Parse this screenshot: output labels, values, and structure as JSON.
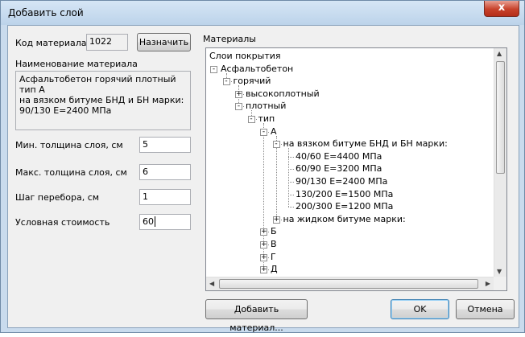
{
  "window": {
    "title": "Добавить слой",
    "close_glyph": "x"
  },
  "material": {
    "code_label": "Код материала",
    "code_value": "1022",
    "assign_button": "Назначить",
    "name_label": "Наименование материала",
    "name_value_lines": [
      "Асфальтобетон горячий плотный тип А",
      "на вязком битуме БНД и БН марки:",
      "90/130 E=2400 МПа"
    ]
  },
  "params": {
    "min_label": "Мин. толщина слоя, см",
    "min_value": "5",
    "max_label": "Макс. толщина слоя, см",
    "max_value": "6",
    "step_label": "Шаг перебора, см",
    "step_value": "1",
    "cost_label": "Условная стоимость",
    "cost_value": "60"
  },
  "materials": {
    "label": "Материалы",
    "nodes": [
      {
        "text": "Слои покрытия",
        "level": 0,
        "expander": ""
      },
      {
        "text": "Асфальтобетон",
        "level": 1,
        "expander": "-"
      },
      {
        "text": "горячий",
        "level": 2,
        "expander": "-"
      },
      {
        "text": "высокоплотный",
        "level": 3,
        "expander": "+"
      },
      {
        "text": "плотный",
        "level": 3,
        "expander": "-"
      },
      {
        "text": "тип",
        "level": 4,
        "expander": "-"
      },
      {
        "text": "А",
        "level": 5,
        "expander": "-"
      },
      {
        "text": "на вязком битуме БНД и БН марки:",
        "level": 6,
        "expander": "-"
      },
      {
        "text": "40/60 E=4400 МПа",
        "level": 7,
        "expander": ""
      },
      {
        "text": "60/90 E=3200 МПа",
        "level": 7,
        "expander": ""
      },
      {
        "text": "90/130 E=2400 МПа",
        "level": 7,
        "expander": ""
      },
      {
        "text": "130/200 E=1500 МПа",
        "level": 7,
        "expander": ""
      },
      {
        "text": "200/300 E=1200 МПа",
        "level": 7,
        "expander": ""
      },
      {
        "text": "на жидком битуме марки:",
        "level": 6,
        "expander": "+"
      },
      {
        "text": "Б",
        "level": 5,
        "expander": "+"
      },
      {
        "text": "В",
        "level": 5,
        "expander": "+"
      },
      {
        "text": "Г",
        "level": 5,
        "expander": "+"
      },
      {
        "text": "Д",
        "level": 5,
        "expander": "+"
      }
    ]
  },
  "buttons": {
    "add_material": "Добавить материал...",
    "ok": "OK",
    "cancel": "Отмена"
  }
}
